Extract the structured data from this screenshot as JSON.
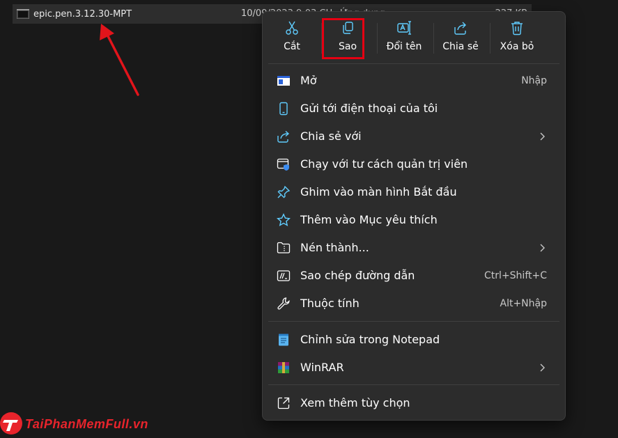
{
  "file": {
    "name": "epic.pen.3.12.30-MPT",
    "date": "10/09/2023 9:03 CH",
    "type": "Ứng dụng",
    "size": "227 KB",
    "icon": "exe-file-icon"
  },
  "quick_actions": [
    {
      "label": "Cắt",
      "icon": "scissors-icon"
    },
    {
      "label": "Sao",
      "icon": "copy-icon"
    },
    {
      "label": "Đổi tên",
      "icon": "rename-icon"
    },
    {
      "label": "Chia sẻ",
      "icon": "share-icon"
    },
    {
      "label": "Xóa bỏ",
      "icon": "trash-icon"
    }
  ],
  "menu_items": [
    {
      "label": "Mở",
      "shortcut": "Nhập",
      "icon": "open-app-icon"
    },
    {
      "label": "Gửi tới điện thoại của tôi",
      "icon": "phone-icon"
    },
    {
      "label": "Chia sẻ với",
      "icon": "share-with-icon",
      "submenu": true
    },
    {
      "label": "Chạy với tư cách quản trị viên",
      "icon": "shield-admin-icon"
    },
    {
      "label": "Ghim vào màn hình Bắt đầu",
      "icon": "pin-icon"
    },
    {
      "label": "Thêm vào Mục yêu thích",
      "icon": "star-icon"
    },
    {
      "label": "Nén thành...",
      "icon": "zip-folder-icon",
      "submenu": true
    },
    {
      "label": "Sao chép đường dẫn",
      "shortcut": "Ctrl+Shift+C",
      "icon": "copy-path-icon"
    },
    {
      "label": "Thuộc tính",
      "shortcut": "Alt+Nhập",
      "icon": "wrench-icon"
    },
    {
      "label": "Chỉnh sửa trong Notepad",
      "icon": "notepad-icon"
    },
    {
      "label": "WinRAR",
      "icon": "winrar-icon",
      "submenu": true
    },
    {
      "label": "Xem thêm tùy chọn",
      "icon": "more-options-icon"
    }
  ],
  "watermark": {
    "text": "TaiPhanMemFull.vn"
  },
  "colors": {
    "accent": "#60cdff",
    "highlight": "#e60012",
    "menu_bg": "#2c2c2c"
  }
}
